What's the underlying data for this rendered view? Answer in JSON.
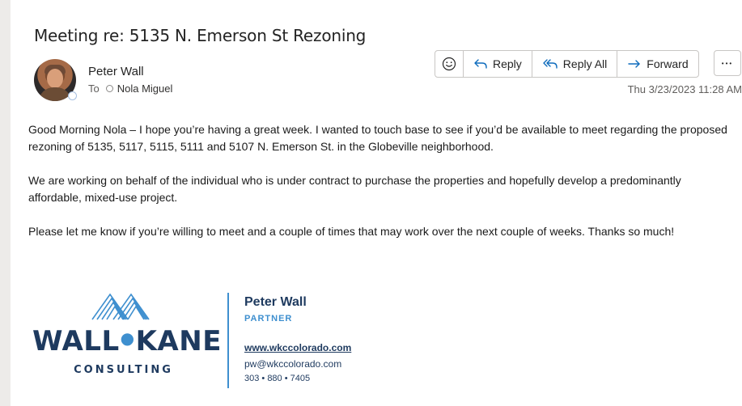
{
  "email": {
    "subject": "Meeting re: 5135 N. Emerson St Rezoning",
    "sender_name": "Peter Wall",
    "to_label": "To",
    "recipient": "Nola Miguel",
    "timestamp": "Thu 3/23/2023 11:28 AM"
  },
  "toolbar": {
    "reply": "Reply",
    "reply_all": "Reply All",
    "forward": "Forward",
    "more": "•••"
  },
  "body": {
    "paragraphs": [
      "Good Morning Nola – I hope you’re having a great week. I wanted to touch base to see if you’d be available to meet regarding the proposed rezoning of 5135, 5117, 5115, 5111 and 5107 N. Emerson St. in the Globeville neighborhood.",
      "We are working on behalf of the individual who is under contract to purchase the properties and hopefully develop a predominantly affordable, mixed-use project.",
      "Please let me know if you’re willing to meet and a couple of times that may work over the next couple of weeks. Thanks so much!"
    ]
  },
  "signature": {
    "logo_word_left": "WALL",
    "logo_word_right": "KANE",
    "logo_sub": "CONSULTING",
    "name": "Peter Wall",
    "title": "PARTNER",
    "website": "www.wkccolorado.com",
    "email": "pw@wkccolorado.com",
    "phone": "303 • 880 • 7405"
  },
  "colors": {
    "accent": "#0f6cbd",
    "brand_navy": "#1e3a5f",
    "brand_blue": "#3e8fcf"
  },
  "icons": [
    "emoji-icon",
    "reply-icon",
    "reply-all-icon",
    "forward-icon",
    "more-icon",
    "presence-icon"
  ]
}
